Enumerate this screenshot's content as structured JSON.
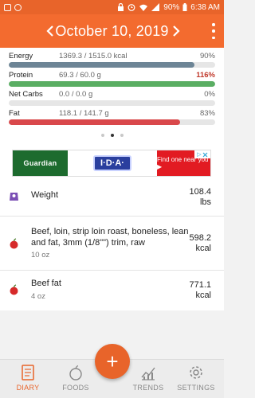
{
  "status_bar": {
    "battery": "90%",
    "time": "6:38 AM"
  },
  "header": {
    "date": "October 10, 2019"
  },
  "nutrients": [
    {
      "name": "Energy",
      "amount": "1369.3 / 1515.0 kcal",
      "percent": "90%",
      "fill": 0.9,
      "color": "#6d8596"
    },
    {
      "name": "Protein",
      "amount": "69.3 / 60.0 g",
      "percent": "116%",
      "fill": 1.0,
      "color": "#5aae63"
    },
    {
      "name": "Net Carbs",
      "amount": "0.0 / 0.0 g",
      "percent": "0%",
      "fill": 0.0,
      "color": "#8a9ba8"
    },
    {
      "name": "Fat",
      "amount": "118.1 / 141.7 g",
      "percent": "83%",
      "fill": 0.83,
      "color": "#d9484b"
    }
  ],
  "ad": {
    "brand1": "Guardian",
    "brand2": "I·D·A·",
    "cta": "Find one near you ▶"
  },
  "entries": [
    {
      "title": "Weight",
      "value_line1": "108.4",
      "value_line2": "lbs",
      "sub": ""
    },
    {
      "title": "Beef, loin, strip loin roast, boneless, lean and fat, 3mm (1/8\"\") trim, raw",
      "value_line1": "598.2",
      "value_line2": "kcal",
      "sub": "10 oz"
    },
    {
      "title": "Beef fat",
      "value_line1": "771.1",
      "value_line2": "kcal",
      "sub": "4 oz"
    }
  ],
  "nav": {
    "diary": "DIARY",
    "foods": "FOODS",
    "trends": "TRENDS",
    "settings": "SETTINGS"
  },
  "fab_label": "+",
  "colors": {
    "brand": "#f36b2f",
    "status": "#e8642a"
  }
}
